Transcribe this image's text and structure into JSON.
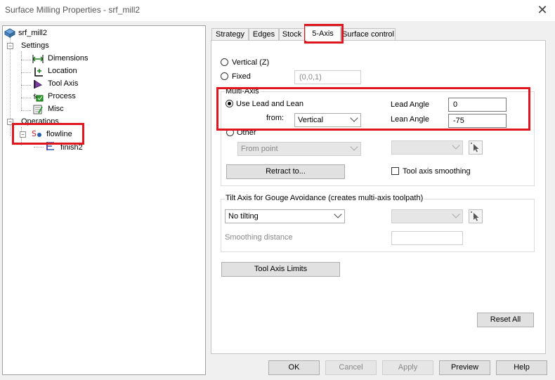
{
  "window": {
    "title": "Surface Milling Properties - srf_mill2"
  },
  "tree": {
    "root": "srf_mill2",
    "settings": "Settings",
    "settings_items": [
      "Dimensions",
      "Location",
      "Tool Axis",
      "Process",
      "Misc"
    ],
    "operations": "Operations",
    "operation": "flowline",
    "sub_operation": "finish2"
  },
  "tabs": [
    "Strategy",
    "Edges",
    "Stock",
    "5-Axis",
    "Surface control"
  ],
  "five_axis": {
    "vertical_label": "Vertical (Z)",
    "fixed_label": "Fixed",
    "fixed_value": "(0,0,1)",
    "multi_axis": {
      "group_label": "Multi-Axis",
      "use_lead_lean_label": "Use Lead and Lean",
      "from_label": "from:",
      "from_value": "Vertical",
      "lead_angle_label": "Lead Angle",
      "lead_angle_value": "0",
      "lean_angle_label": "Lean Angle",
      "lean_angle_value": "-75",
      "other_label": "Other",
      "other_select": "From point",
      "retract_button": "Retract to...",
      "smoothing_label": "Tool axis smoothing"
    },
    "tilt": {
      "group_label": "Tilt Axis for Gouge Avoidance (creates multi-axis toolpath)",
      "tilt_select": "No tilting",
      "smoothing_distance_label": "Smoothing distance"
    },
    "tool_axis_limits_button": "Tool Axis Limits",
    "reset_all_button": "Reset All"
  },
  "footer": {
    "ok": "OK",
    "cancel": "Cancel",
    "apply": "Apply",
    "preview": "Preview",
    "help": "Help"
  },
  "colors": {
    "highlight": "#e0161f",
    "panel_bg": "#f0f0f0"
  }
}
